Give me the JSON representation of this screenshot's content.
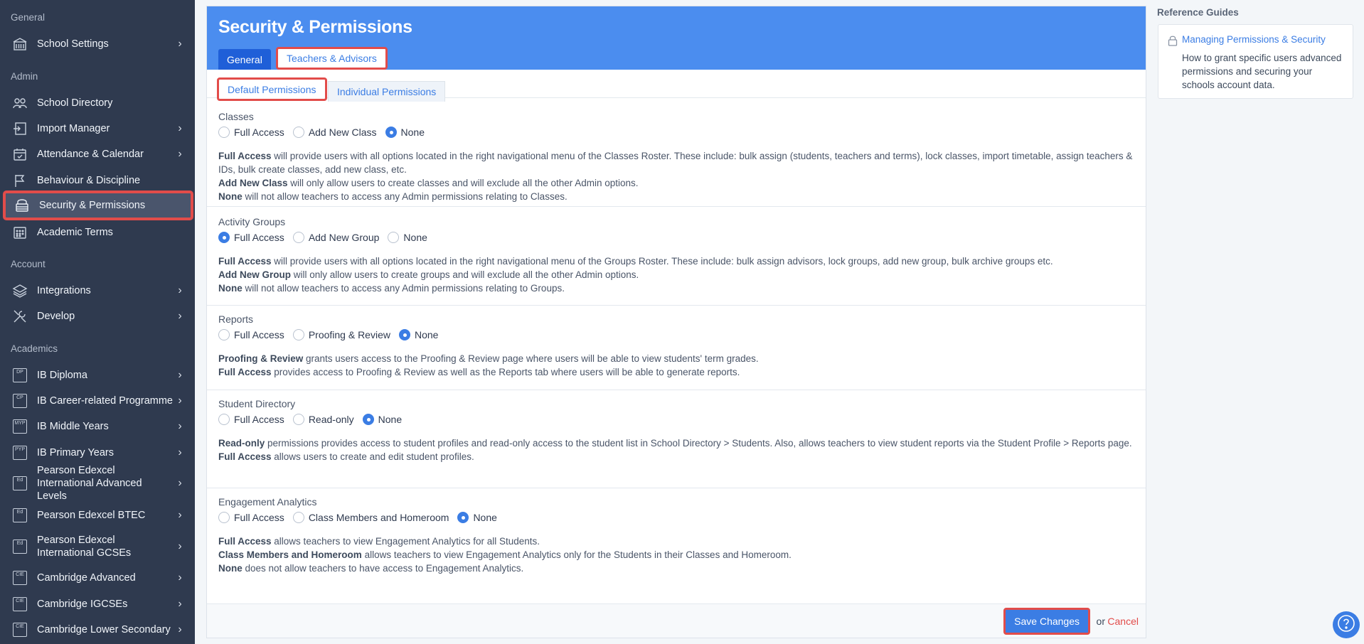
{
  "sidebar": {
    "sections": [
      "General",
      "Admin",
      "Account",
      "Academics"
    ],
    "items": [
      {
        "label": "School Settings",
        "icon": "school-icon"
      },
      {
        "label": "School Directory",
        "icon": "people-icon"
      },
      {
        "label": "Import Manager",
        "icon": "import-icon"
      },
      {
        "label": "Attendance & Calendar",
        "icon": "calendar-check-icon"
      },
      {
        "label": "Behaviour & Discipline",
        "icon": "flag-icon"
      },
      {
        "label": "Security & Permissions",
        "icon": "security-icon"
      },
      {
        "label": "Academic Terms",
        "icon": "grid-calendar-icon"
      },
      {
        "label": "Integrations",
        "icon": "layers-icon"
      },
      {
        "label": "Develop",
        "icon": "tools-icon"
      },
      {
        "label": "IB Diploma",
        "badge": "DP"
      },
      {
        "label": "IB Career-related Programme",
        "badge": "CP"
      },
      {
        "label": "IB Middle Years",
        "badge": "MYP"
      },
      {
        "label": "IB Primary Years",
        "badge": "PYP"
      },
      {
        "label": "Pearson Edexcel International Advanced Levels",
        "badge": "Ed"
      },
      {
        "label": "Pearson Edexcel BTEC",
        "badge": "Ed"
      },
      {
        "label": "Pearson Edexcel International GCSEs",
        "badge": "Ed"
      },
      {
        "label": "Cambridge Advanced",
        "badge": "CIE"
      },
      {
        "label": "Cambridge IGCSEs",
        "badge": "CIE"
      },
      {
        "label": "Cambridge Lower Secondary",
        "badge": "CIE"
      }
    ]
  },
  "page": {
    "title": "Security & Permissions",
    "tabs": [
      "General",
      "Teachers & Advisors"
    ],
    "subtabs": [
      "Default Permissions",
      "Individual Permissions"
    ]
  },
  "groups": [
    {
      "title": "Classes",
      "options": [
        "Full Access",
        "Add New Class",
        "None"
      ],
      "selected": 2,
      "desc": [
        {
          "b": "Full Access",
          "t": " will provide users with all options located in the right navigational menu of the Classes Roster. These include: bulk assign (students, teachers and terms), lock classes, import timetable, assign teachers & IDs, bulk create classes, add new class, etc."
        },
        {
          "b": "Add New Class",
          "t": " will only allow users to create classes and will exclude all the other Admin options."
        },
        {
          "b": "None",
          "t": " will not allow teachers to access any Admin permissions relating to Classes."
        }
      ]
    },
    {
      "title": "Activity Groups",
      "options": [
        "Full Access",
        "Add New Group",
        "None"
      ],
      "selected": 0,
      "desc": [
        {
          "b": "Full Access",
          "t": " will provide users with all options located in the right navigational menu of the Groups Roster. These include: bulk assign advisors, lock groups, add new group, bulk archive groups etc."
        },
        {
          "b": "Add New Group",
          "t": " will only allow users to create groups and will exclude all the other Admin options."
        },
        {
          "b": "None",
          "t": " will not allow teachers to access any Admin permissions relating to Groups."
        }
      ]
    },
    {
      "title": "Reports",
      "options": [
        "Full Access",
        "Proofing & Review",
        "None"
      ],
      "selected": 2,
      "desc": [
        {
          "b": "Proofing & Review",
          "t": " grants users access to the Proofing & Review page where users will be able to view students' term grades."
        },
        {
          "b": "Full Access",
          "t": " provides access to Proofing & Review as well as the Reports tab where users will be able to generate reports."
        }
      ]
    },
    {
      "title": "Student Directory",
      "options": [
        "Full Access",
        "Read-only",
        "None"
      ],
      "selected": 2,
      "desc": [
        {
          "b": "Read-only",
          "t": " permissions provides access to student profiles and read-only access to the student list in School Directory > Students. Also, allows teachers to view student reports via the Student Profile > Reports page."
        },
        {
          "b": "Full Access",
          "t": " allows users to create and edit student profiles."
        }
      ]
    },
    {
      "title": "Engagement Analytics",
      "options": [
        "Full Access",
        "Class Members and Homeroom",
        "None"
      ],
      "selected": 2,
      "desc": [
        {
          "b": "Full Access",
          "t": " allows teachers to view Engagement Analytics for all Students."
        },
        {
          "b": "Class Members and Homeroom",
          "t": " allows teachers to view Engagement Analytics only for the Students in their Classes and Homeroom."
        },
        {
          "b": "None",
          "t": " does not allow teachers to have access to Engagement Analytics."
        }
      ]
    }
  ],
  "footer": {
    "save": "Save Changes",
    "or": "or",
    "cancel": "Cancel"
  },
  "reference": {
    "title": "Reference Guides",
    "link": "Managing Permissions & Security",
    "desc": "How to grant specific users advanced permissions and securing your schools account data."
  },
  "colors": {
    "sidebar": "#2f3a4f",
    "accent": "#3b7de4",
    "header": "#4b8def",
    "highlight": "#e24c4a"
  }
}
